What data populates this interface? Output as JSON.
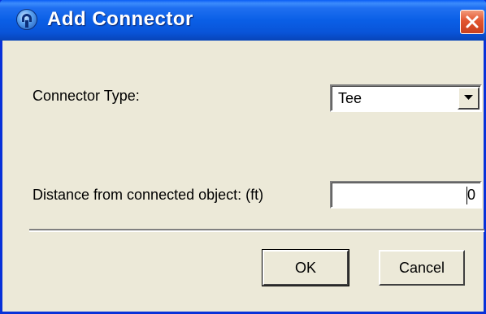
{
  "window": {
    "title": "Add Connector",
    "icon": "app-logo-icon",
    "close_icon": "close-icon"
  },
  "form": {
    "connector_type_label": "Connector Type:",
    "connector_type_value": "Tee",
    "distance_label": "Distance from connected object: (ft)",
    "distance_value": "0"
  },
  "buttons": {
    "ok_label": "OK",
    "cancel_label": "Cancel"
  },
  "colors": {
    "titlebar": "#0a5fe6",
    "dialog_bg": "#ece9d8",
    "close_button": "#e2552f"
  }
}
